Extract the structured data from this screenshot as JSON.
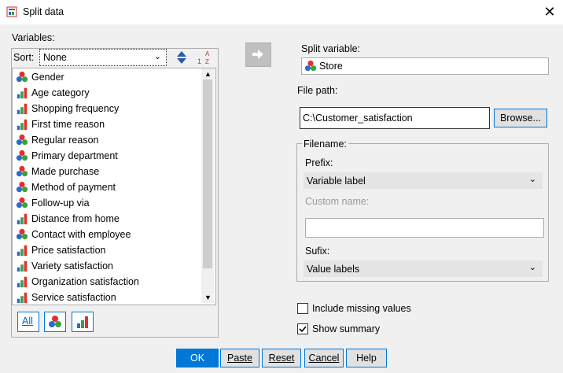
{
  "window": {
    "title": "Split data",
    "close_glyph": "✕"
  },
  "variables_panel": {
    "label": "Variables:",
    "sort_label": "Sort:",
    "sort_value": "None",
    "items": [
      {
        "label": "Gender",
        "icon": "nominal-icon"
      },
      {
        "label": "Age category",
        "icon": "ordinal-icon"
      },
      {
        "label": "Shopping frequency",
        "icon": "ordinal-icon"
      },
      {
        "label": "First time reason",
        "icon": "ordinal-icon"
      },
      {
        "label": "Regular reason",
        "icon": "nominal-icon"
      },
      {
        "label": "Primary department",
        "icon": "nominal-icon"
      },
      {
        "label": "Made purchase",
        "icon": "nominal-icon"
      },
      {
        "label": "Method of payment",
        "icon": "nominal-icon"
      },
      {
        "label": "Follow-up via",
        "icon": "nominal-icon"
      },
      {
        "label": "Distance from home",
        "icon": "ordinal-icon"
      },
      {
        "label": "Contact with employee",
        "icon": "nominal-icon"
      },
      {
        "label": "Price satisfaction",
        "icon": "ordinal-icon"
      },
      {
        "label": "Variety satisfaction",
        "icon": "ordinal-icon"
      },
      {
        "label": "Organization satisfaction",
        "icon": "ordinal-icon"
      },
      {
        "label": "Service satisfaction",
        "icon": "ordinal-icon"
      }
    ],
    "filter_all_label": "All"
  },
  "split": {
    "label": "Split variable:",
    "value": "Store"
  },
  "file_path": {
    "label": "File path:",
    "value": "C:\\Customer_satisfaction",
    "browse_label": "Browse..."
  },
  "filename": {
    "group_label": "Filename:",
    "prefix_label": "Prefix:",
    "prefix_value": "Variable label",
    "custom_label": "Custom name:",
    "custom_value": "",
    "sufix_label": "Sufix:",
    "sufix_value": "Value labels"
  },
  "options": {
    "include_missing": {
      "label": "Include missing values",
      "checked": false
    },
    "show_summary": {
      "label": "Show summary",
      "checked": true
    }
  },
  "buttons": {
    "ok": "OK",
    "paste": "Paste",
    "reset": "Reset",
    "cancel": "Cancel",
    "help": "Help"
  },
  "colors": {
    "accent": "#0078d7",
    "nominal_red": "#e03030",
    "nominal_green": "#3aa040",
    "nominal_blue": "#2a6ad0"
  }
}
